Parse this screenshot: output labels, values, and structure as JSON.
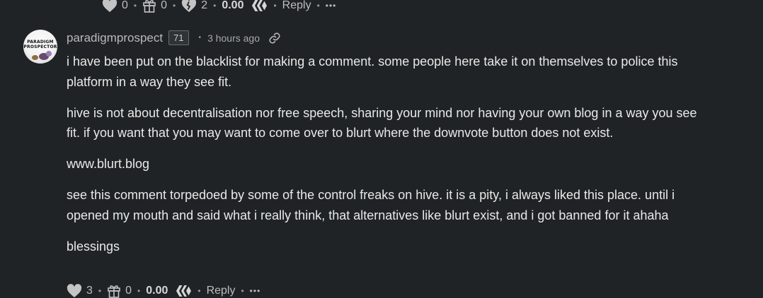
{
  "prev_actions": {
    "upvotes": "0",
    "gifts": "0",
    "downvotes": "2",
    "payout": "0.00",
    "reply_label": "Reply",
    "more_label": "•••"
  },
  "comment": {
    "avatar_text_line1": "PARADIGM",
    "avatar_text_line2": "PROSPECTOR",
    "author": "paradigmprospect",
    "reputation": "71",
    "time": "3 hours ago",
    "paragraphs": [
      "i have been put on the blacklist for making a comment. some people here take it on themselves to police this platform in a way they see fit.",
      "hive is not about decentralisation nor free speech, sharing your mind nor having your own blog in a way you see fit. if you want that you may want to come over to blurt where the downvote button does not exist.",
      "www.blurt.blog",
      "see this comment torpedoed by some of the control freaks on hive. it is a pity, i always liked this place. until i opened my mouth and said what i really think, that alternatives like blurt exist, and i got banned for it ahaha",
      "blessings"
    ],
    "actions": {
      "upvotes": "3",
      "gifts": "0",
      "payout": "0.00",
      "reply_label": "Reply",
      "more_label": "•••"
    }
  },
  "icons": {
    "upvote": "heart-icon",
    "gift": "gift-icon",
    "downvote": "broken-heart-icon",
    "hive": "hive-logo-icon",
    "link": "link-icon"
  },
  "colors": {
    "background": "#1f2325",
    "text": "#e9e9e9",
    "muted": "#b9b9b9",
    "rep_border": "#6c6c6c"
  }
}
